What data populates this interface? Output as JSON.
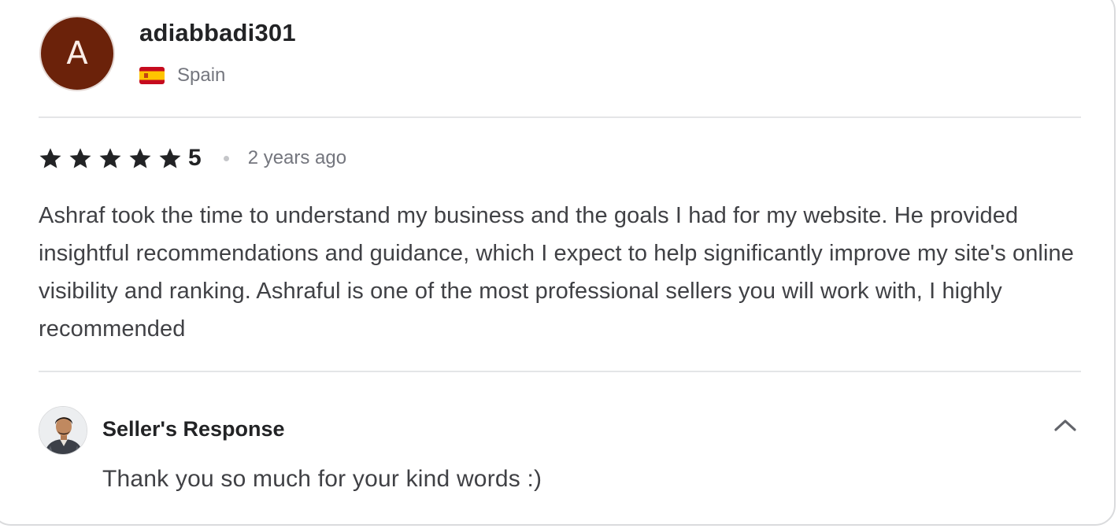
{
  "reviewer": {
    "avatar_initial": "A",
    "avatar_color": "#6b220a",
    "username": "adiabbadi301",
    "country": "Spain",
    "flag_icon": "spain-flag-icon"
  },
  "rating": {
    "value": "5",
    "stars_filled": 5,
    "stars_total": 5,
    "star_icon": "star-icon",
    "time_ago": "2 years ago"
  },
  "review": {
    "text": "Ashraf took the time to understand my business and the goals I had for my website. He provided insightful recommendations and guidance, which I expect to help significantly improve my site's online visibility and ranking. Ashraful is one of the most professional sellers you will work with, I highly recommended"
  },
  "seller_response": {
    "title": "Seller's Response",
    "text": "Thank you so much for your kind words :)",
    "toggle_icon": "chevron-up-icon"
  },
  "colors": {
    "text_primary": "#222325",
    "text_body": "#404145",
    "text_muted": "#74767e",
    "divider": "#e4e5e7"
  }
}
